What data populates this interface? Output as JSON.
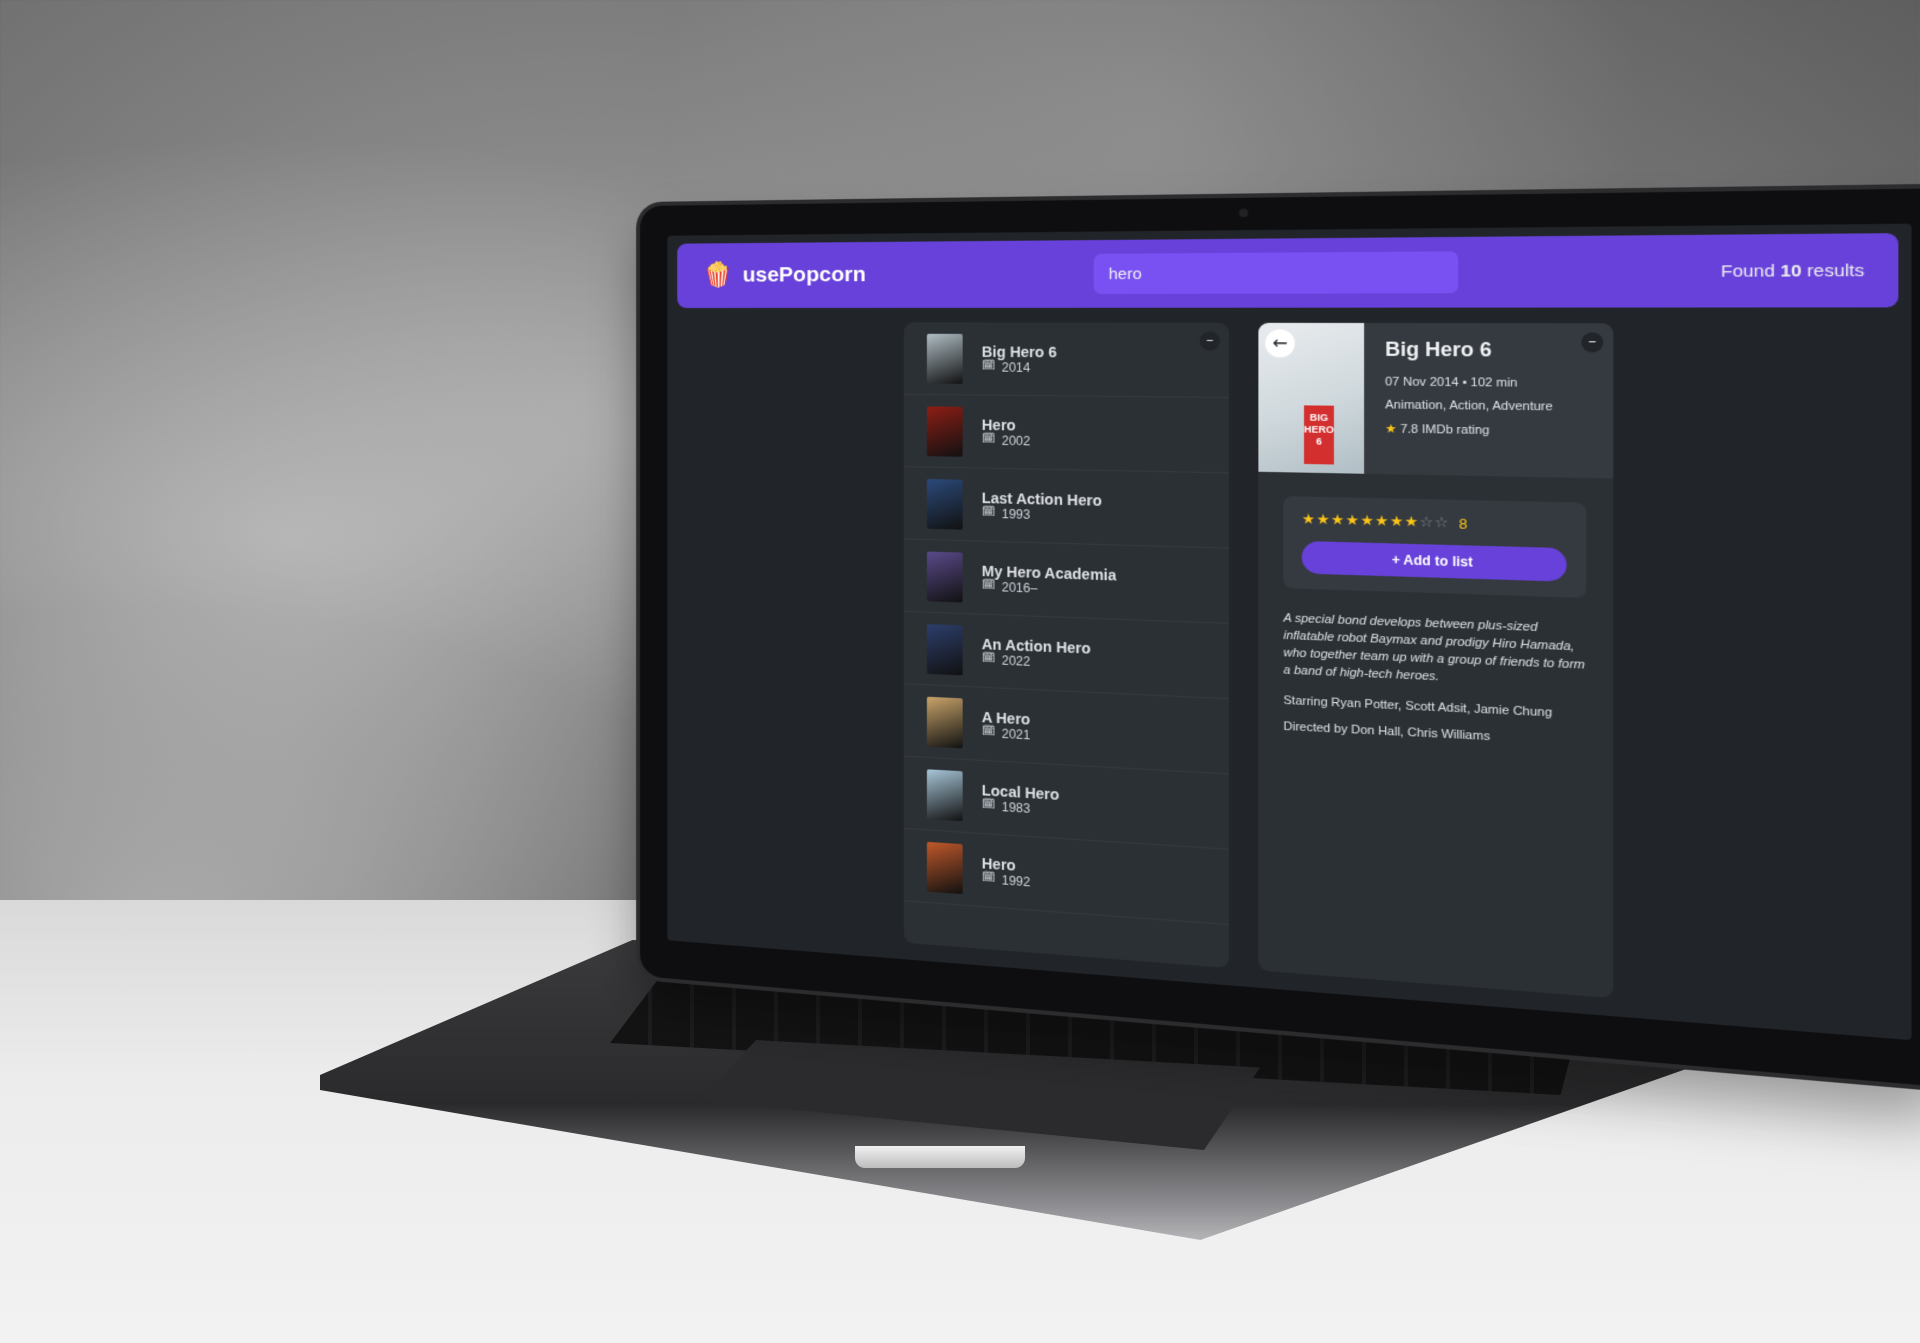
{
  "app": {
    "logo_icon": "🍿",
    "logo_text": "usePopcorn",
    "search_value": "hero",
    "results_prefix": "Found",
    "results_count": "10",
    "results_suffix": "results"
  },
  "list": {
    "toggle_label": "–",
    "year_icon": "🗓",
    "movies": [
      {
        "title": "Big Hero 6",
        "year": "2014",
        "poster_color": "#b0bec5"
      },
      {
        "title": "Hero",
        "year": "2002",
        "poster_color": "#8d1e14"
      },
      {
        "title": "Last Action Hero",
        "year": "1993",
        "poster_color": "#2b4a7a"
      },
      {
        "title": "My Hero Academia",
        "year": "2016–",
        "poster_color": "#5a4a8a"
      },
      {
        "title": "An Action Hero",
        "year": "2022",
        "poster_color": "#2c3e6b"
      },
      {
        "title": "A Hero",
        "year": "2021",
        "poster_color": "#c9a46a"
      },
      {
        "title": "Local Hero",
        "year": "1983",
        "poster_color": "#a8c6d8"
      },
      {
        "title": "Hero",
        "year": "1992",
        "poster_color": "#c0582a"
      }
    ]
  },
  "details": {
    "toggle_label": "–",
    "back_label": "←",
    "poster_badge": "BIG HERO 6",
    "title": "Big Hero 6",
    "released_runtime": "07 Nov 2014 • 102 min",
    "genre": "Animation, Action, Adventure",
    "imdb_star": "★",
    "imdb_rating": "7.8 IMDb rating",
    "user_rating": 8,
    "max_rating": 10,
    "rating_label": "8",
    "add_button": "+ Add to list",
    "plot": "A special bond develops between plus-sized inflatable robot Baymax and prodigy Hiro Hamada, who together team up with a group of friends to form a band of high-tech heroes.",
    "starring": "Starring Ryan Potter, Scott Adsit, Jamie Chung",
    "directed": "Directed by Don Hall, Chris Williams"
  },
  "colors": {
    "primary": "#6741d9",
    "primary_light": "#7950f2",
    "background": "#212529",
    "box": "#2b3035",
    "star": "#fcc419"
  }
}
